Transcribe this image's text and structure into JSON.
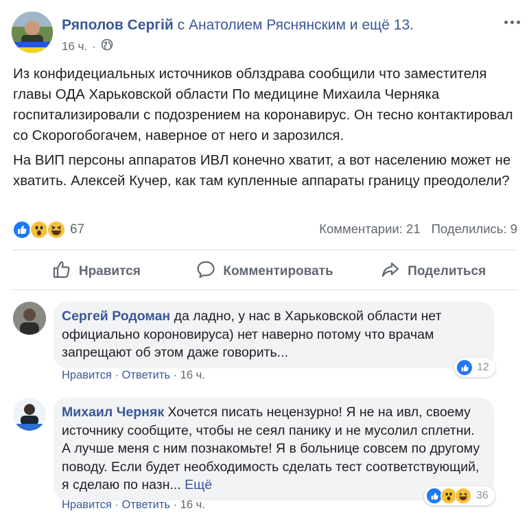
{
  "post": {
    "author": "Ряполов Сергій",
    "with_text": "с Анатолием Ряснянским и ещё 13.",
    "time": "16 ч.",
    "privacy_icon": "globe-icon",
    "more_icon": "ellipsis-icon",
    "paragraph_1": "Из конфидециальных источников облздрава сообщили что заместителя главы ОДА Харьковской области По медицине Михаила Черняка госпитализировали с подозрением на коронавирус. Он тесно контактировал со Скорогобогачем, наверное от него и зарозился.",
    "paragraph_2": "На ВИП персоны аппаратов ИВЛ конечно хватит, а вот населению может не хватить. Алексей Кучер, как там купленные аппараты границу преодолели?",
    "reaction_count": "67",
    "reaction_icons": [
      "like-icon",
      "wow-icon",
      "haha-icon"
    ],
    "comments_stat": "Комментарии: 21",
    "shares_stat": "Поделились: 9"
  },
  "actions": {
    "like": "Нравится",
    "comment": "Комментировать",
    "share": "Поделиться"
  },
  "comments": [
    {
      "name": "Сергей Родоман",
      "text": "да ладно, у нас в Харьковской области нет официально короновируса) нет наверно потому что врачам запрещают об этом даже говорить...",
      "like_label": "Нравится",
      "reply_label": "Ответить",
      "time": "16 ч.",
      "reaction_count": "12"
    },
    {
      "name": "Михаил Черняк",
      "text": "Хочется писать нецензурно! Я не на ивл, своему источнику сообщите, чтобы не сеял панику и не мусолил сплетни. А лучше меня с ним познакомьте! Я в больнице совсем по другому поводу. Если будет необходимость сделать тест соответствующий, я сделаю по назн...",
      "more_label": "Ещё",
      "like_label": "Нравится",
      "reply_label": "Ответить",
      "time": "16 ч.",
      "reaction_count": "36"
    }
  ],
  "colors": {
    "link": "#385898",
    "meta": "#606770",
    "like_blue": "#2078f4",
    "emoji_yellow": "#f7c03b",
    "bubble": "#f2f3f5",
    "divider": "#dadde1"
  }
}
